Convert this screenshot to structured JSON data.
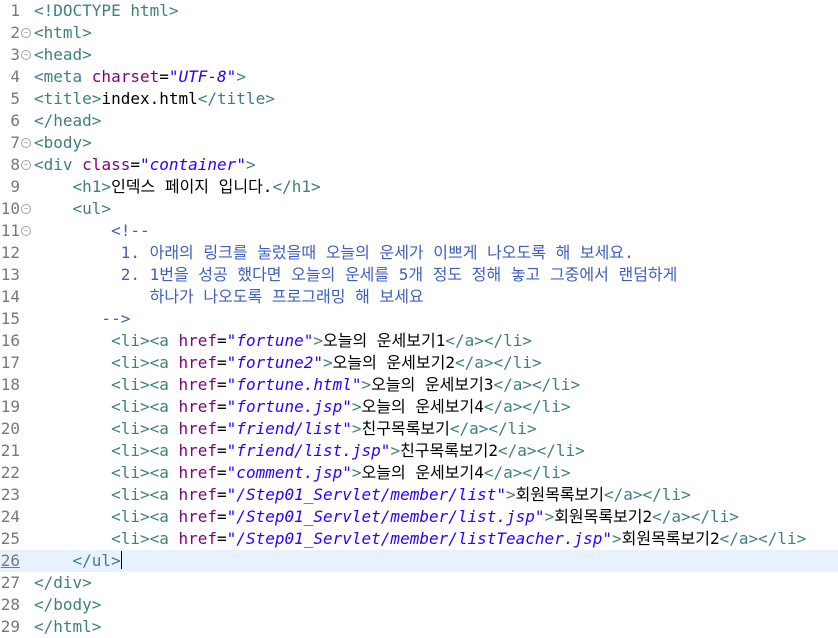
{
  "editor": {
    "current_line": 26,
    "lines": [
      {
        "n": "1",
        "fold": false,
        "segs": [
          {
            "c": "t",
            "s": "<!DOCTYPE html>"
          }
        ]
      },
      {
        "n": "2",
        "fold": true,
        "segs": [
          {
            "c": "t",
            "s": "<html>"
          }
        ]
      },
      {
        "n": "3",
        "fold": true,
        "segs": [
          {
            "c": "t",
            "s": "<head>"
          }
        ]
      },
      {
        "n": "4",
        "fold": false,
        "segs": [
          {
            "c": "t",
            "s": "<meta "
          },
          {
            "c": "a",
            "s": "charset"
          },
          {
            "c": "x",
            "s": "="
          },
          {
            "c": "v",
            "s": "\"UTF-8\""
          },
          {
            "c": "t",
            "s": ">"
          }
        ]
      },
      {
        "n": "5",
        "fold": false,
        "segs": [
          {
            "c": "t",
            "s": "<title>"
          },
          {
            "c": "x",
            "s": "index.html"
          },
          {
            "c": "t",
            "s": "</title>"
          }
        ]
      },
      {
        "n": "6",
        "fold": false,
        "segs": [
          {
            "c": "t",
            "s": "</head>"
          }
        ]
      },
      {
        "n": "7",
        "fold": true,
        "segs": [
          {
            "c": "t",
            "s": "<body>"
          }
        ]
      },
      {
        "n": "8",
        "fold": true,
        "segs": [
          {
            "c": "t",
            "s": "<div "
          },
          {
            "c": "a",
            "s": "class"
          },
          {
            "c": "x",
            "s": "="
          },
          {
            "c": "v",
            "s": "\"container\""
          },
          {
            "c": "t",
            "s": ">"
          }
        ]
      },
      {
        "n": "9",
        "fold": false,
        "segs": [
          {
            "c": "x",
            "s": "    "
          },
          {
            "c": "t",
            "s": "<h1>"
          },
          {
            "c": "x",
            "s": "인덱스 페이지 입니다."
          },
          {
            "c": "t",
            "s": "</h1>"
          }
        ]
      },
      {
        "n": "10",
        "fold": true,
        "segs": [
          {
            "c": "x",
            "s": "    "
          },
          {
            "c": "t",
            "s": "<ul>"
          }
        ]
      },
      {
        "n": "11",
        "fold": true,
        "segs": [
          {
            "c": "x",
            "s": "        "
          },
          {
            "c": "c",
            "s": "<!--"
          }
        ]
      },
      {
        "n": "12",
        "fold": false,
        "segs": [
          {
            "c": "c",
            "s": "         1. 아래의 링크를 눌렀을때 오늘의 운세가 이쁘게 나오도록 해 보세요."
          }
        ]
      },
      {
        "n": "13",
        "fold": false,
        "segs": [
          {
            "c": "c",
            "s": "         2. 1번을 성공 했다면 오늘의 운세를 5개 정도 정해 놓고 그중에서 랜덤하게"
          }
        ]
      },
      {
        "n": "14",
        "fold": false,
        "segs": [
          {
            "c": "c",
            "s": "            하나가 나오도록 프로그래밍 해 보세요"
          }
        ]
      },
      {
        "n": "15",
        "fold": false,
        "segs": [
          {
            "c": "c",
            "s": "       -->"
          }
        ]
      },
      {
        "n": "16",
        "fold": false,
        "segs": [
          {
            "c": "x",
            "s": "        "
          },
          {
            "c": "t",
            "s": "<li><a "
          },
          {
            "c": "a",
            "s": "href"
          },
          {
            "c": "x",
            "s": "="
          },
          {
            "c": "v",
            "s": "\"fortune\""
          },
          {
            "c": "t",
            "s": ">"
          },
          {
            "c": "x",
            "s": "오늘의 운세보기1"
          },
          {
            "c": "t",
            "s": "</a></li>"
          }
        ]
      },
      {
        "n": "17",
        "fold": false,
        "segs": [
          {
            "c": "x",
            "s": "        "
          },
          {
            "c": "t",
            "s": "<li><a "
          },
          {
            "c": "a",
            "s": "href"
          },
          {
            "c": "x",
            "s": "="
          },
          {
            "c": "v",
            "s": "\"fortune2\""
          },
          {
            "c": "t",
            "s": ">"
          },
          {
            "c": "x",
            "s": "오늘의 운세보기2"
          },
          {
            "c": "t",
            "s": "</a></li>"
          }
        ]
      },
      {
        "n": "18",
        "fold": false,
        "segs": [
          {
            "c": "x",
            "s": "        "
          },
          {
            "c": "t",
            "s": "<li><a "
          },
          {
            "c": "a",
            "s": "href"
          },
          {
            "c": "x",
            "s": "="
          },
          {
            "c": "v",
            "s": "\"fortune.html\""
          },
          {
            "c": "t",
            "s": ">"
          },
          {
            "c": "x",
            "s": "오늘의 운세보기3"
          },
          {
            "c": "t",
            "s": "</a></li>"
          }
        ]
      },
      {
        "n": "19",
        "fold": false,
        "segs": [
          {
            "c": "x",
            "s": "        "
          },
          {
            "c": "t",
            "s": "<li><a "
          },
          {
            "c": "a",
            "s": "href"
          },
          {
            "c": "x",
            "s": "="
          },
          {
            "c": "v",
            "s": "\"fortune.jsp\""
          },
          {
            "c": "t",
            "s": ">"
          },
          {
            "c": "x",
            "s": "오늘의 운세보기4"
          },
          {
            "c": "t",
            "s": "</a></li>"
          }
        ]
      },
      {
        "n": "20",
        "fold": false,
        "segs": [
          {
            "c": "x",
            "s": "        "
          },
          {
            "c": "t",
            "s": "<li><a "
          },
          {
            "c": "a",
            "s": "href"
          },
          {
            "c": "x",
            "s": "="
          },
          {
            "c": "v",
            "s": "\"friend/list\""
          },
          {
            "c": "t",
            "s": ">"
          },
          {
            "c": "x",
            "s": "친구목록보기"
          },
          {
            "c": "t",
            "s": "</a></li>"
          }
        ]
      },
      {
        "n": "21",
        "fold": false,
        "segs": [
          {
            "c": "x",
            "s": "        "
          },
          {
            "c": "t",
            "s": "<li><a "
          },
          {
            "c": "a",
            "s": "href"
          },
          {
            "c": "x",
            "s": "="
          },
          {
            "c": "v",
            "s": "\"friend/list.jsp\""
          },
          {
            "c": "t",
            "s": ">"
          },
          {
            "c": "x",
            "s": "친구목록보기2"
          },
          {
            "c": "t",
            "s": "</a></li>"
          }
        ]
      },
      {
        "n": "22",
        "fold": false,
        "segs": [
          {
            "c": "x",
            "s": "        "
          },
          {
            "c": "t",
            "s": "<li><a "
          },
          {
            "c": "a",
            "s": "href"
          },
          {
            "c": "x",
            "s": "="
          },
          {
            "c": "v",
            "s": "\"comment.jsp\""
          },
          {
            "c": "t",
            "s": ">"
          },
          {
            "c": "x",
            "s": "오늘의 운세보기4"
          },
          {
            "c": "t",
            "s": "</a></li>"
          }
        ]
      },
      {
        "n": "23",
        "fold": false,
        "segs": [
          {
            "c": "x",
            "s": "        "
          },
          {
            "c": "t",
            "s": "<li><a "
          },
          {
            "c": "a",
            "s": "href"
          },
          {
            "c": "x",
            "s": "="
          },
          {
            "c": "v",
            "s": "\"/Step01_Servlet/member/list\""
          },
          {
            "c": "t",
            "s": ">"
          },
          {
            "c": "x",
            "s": "회원목록보기"
          },
          {
            "c": "t",
            "s": "</a></li>"
          }
        ]
      },
      {
        "n": "24",
        "fold": false,
        "segs": [
          {
            "c": "x",
            "s": "        "
          },
          {
            "c": "t",
            "s": "<li><a "
          },
          {
            "c": "a",
            "s": "href"
          },
          {
            "c": "x",
            "s": "="
          },
          {
            "c": "v",
            "s": "\"/Step01_Servlet/member/list.jsp\""
          },
          {
            "c": "t",
            "s": ">"
          },
          {
            "c": "x",
            "s": "회원목록보기2"
          },
          {
            "c": "t",
            "s": "</a></li>"
          }
        ]
      },
      {
        "n": "25",
        "fold": false,
        "segs": [
          {
            "c": "x",
            "s": "        "
          },
          {
            "c": "t",
            "s": "<li><a "
          },
          {
            "c": "a",
            "s": "href"
          },
          {
            "c": "x",
            "s": "="
          },
          {
            "c": "v",
            "s": "\"/Step01_Servlet/member/listTeacher.jsp\""
          },
          {
            "c": "t",
            "s": ">"
          },
          {
            "c": "x",
            "s": "회원목록보기2"
          },
          {
            "c": "t",
            "s": "</a></li>"
          }
        ]
      },
      {
        "n": "26",
        "fold": false,
        "segs": [
          {
            "c": "x",
            "s": "    "
          },
          {
            "c": "t",
            "s": "</ul>"
          }
        ]
      },
      {
        "n": "27",
        "fold": false,
        "segs": [
          {
            "c": "t",
            "s": "</div>"
          }
        ]
      },
      {
        "n": "28",
        "fold": false,
        "segs": [
          {
            "c": "t",
            "s": "</body>"
          }
        ]
      },
      {
        "n": "29",
        "fold": false,
        "segs": [
          {
            "c": "t",
            "s": "</html>"
          }
        ]
      }
    ]
  }
}
